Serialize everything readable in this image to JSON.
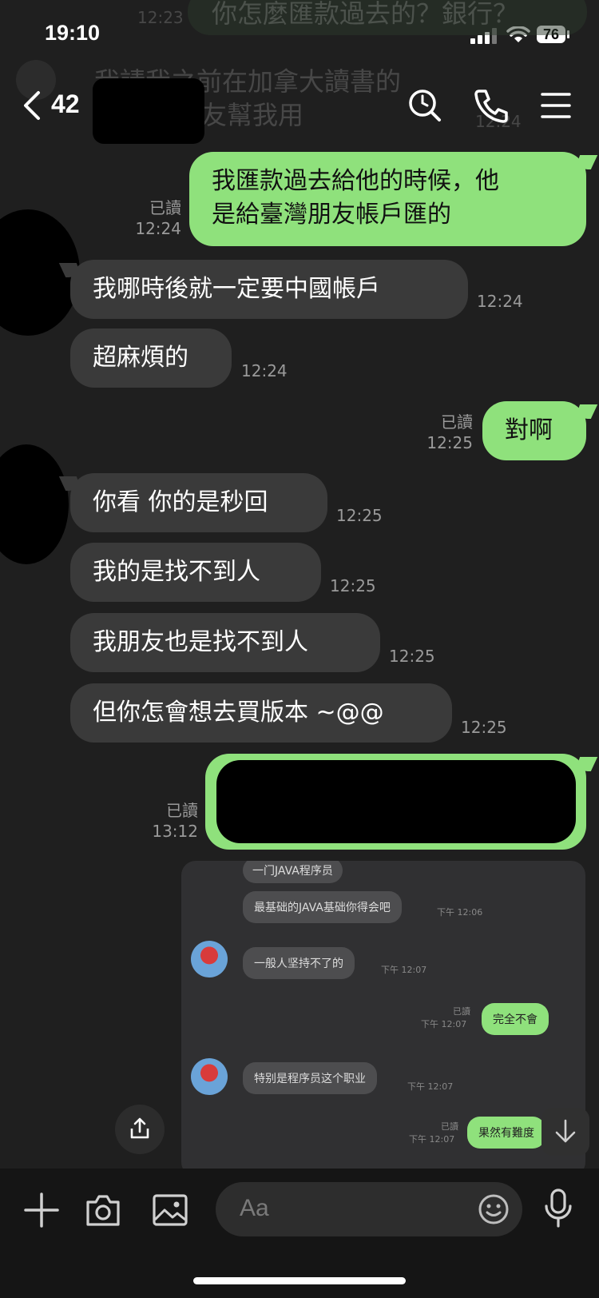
{
  "status": {
    "time": "19:10",
    "battery": "76"
  },
  "ghost": {
    "line1": "你怎麼匯款過去的？銀行？",
    "line2": "我請我之前在加拿大讀書的",
    "line3": "友幫我用",
    "time": "12:23",
    "time2": "12:24"
  },
  "header": {
    "count": "42"
  },
  "messages": {
    "m1": {
      "line1": "我匯款過去給他的時候，他",
      "line2": "是給臺灣朋友帳戶匯的",
      "read": "已讀",
      "time": "12:24"
    },
    "m2": {
      "text": "我哪時後就一定要中國帳戶",
      "time": "12:24"
    },
    "m3": {
      "text": "超麻煩的",
      "time": "12:24"
    },
    "m4": {
      "text": "對啊",
      "read": "已讀",
      "time": "12:25"
    },
    "m5": {
      "text": "你看 你的是秒回",
      "time": "12:25"
    },
    "m6": {
      "text": "我的是找不到人",
      "time": "12:25"
    },
    "m7": {
      "text": "我朋友也是找不到人",
      "time": "12:25"
    },
    "m8": {
      "text": "但你怎會想去買版本 ~@@",
      "time": "12:25"
    },
    "m9": {
      "read": "已讀",
      "time": "13:12"
    }
  },
  "screenshot": {
    "b1": "一门JAVA程序员",
    "b2": "最基础的JAVA基础你得会吧",
    "t2": "下午 12:06",
    "b3": "一般人坚持不了的",
    "t3": "下午 12:07",
    "read4": "已讀",
    "t4": "下午 12:07",
    "b4": "完全不會",
    "b5": "特别是程序员这个职业",
    "t5": "下午 12:07",
    "read6": "已讀",
    "t6": "下午 12:07",
    "b6": "果然有難度"
  },
  "input": {
    "placeholder": "Aa"
  }
}
